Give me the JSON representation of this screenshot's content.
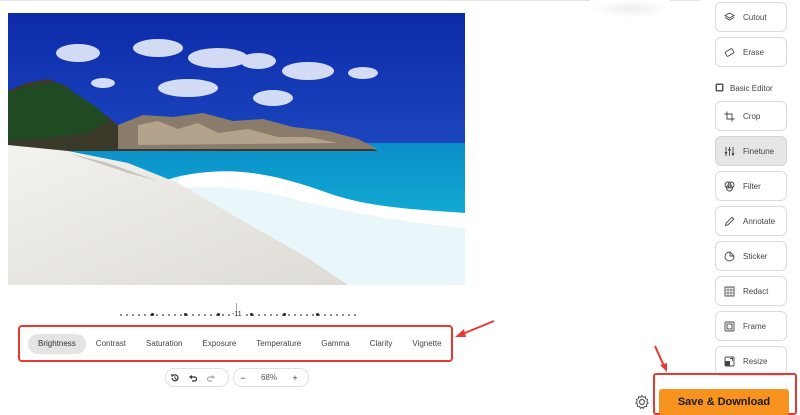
{
  "adjustments": {
    "value": "-11",
    "tabs": [
      "Brightness",
      "Contrast",
      "Saturation",
      "Exposure",
      "Temperature",
      "Gamma",
      "Clarity",
      "Vignette"
    ],
    "active_tab": "Brightness"
  },
  "controls": {
    "zoom": "68%",
    "zoom_out": "−",
    "zoom_in": "+"
  },
  "sidebar": {
    "tools_top": [
      {
        "label": "Cutout",
        "icon": "layers-icon"
      },
      {
        "label": "Erase",
        "icon": "eraser-icon"
      }
    ],
    "section_label": "Basic Editor",
    "tools": [
      {
        "label": "Crop",
        "icon": "crop-icon"
      },
      {
        "label": "Finetune",
        "icon": "sliders-icon",
        "active": true
      },
      {
        "label": "Filter",
        "icon": "filter-icon"
      },
      {
        "label": "Annotate",
        "icon": "pen-icon"
      },
      {
        "label": "Sticker",
        "icon": "sticker-icon"
      },
      {
        "label": "Redact",
        "icon": "redact-icon"
      },
      {
        "label": "Frame",
        "icon": "frame-icon"
      },
      {
        "label": "Resize",
        "icon": "resize-icon"
      }
    ]
  },
  "save": {
    "label": "Save & Download"
  },
  "colors": {
    "accent": "#f7931e",
    "highlight": "#e53935"
  }
}
